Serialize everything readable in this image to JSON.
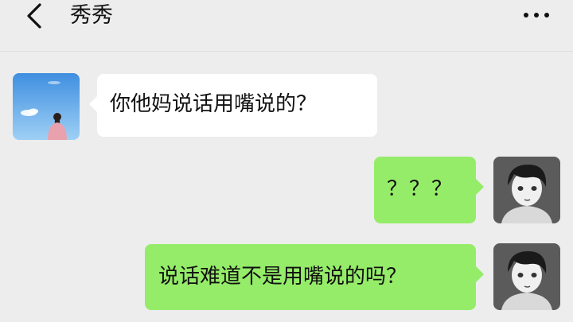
{
  "header": {
    "title": "秀秀",
    "back_icon": "chevron-left-icon",
    "more_icon": "more-dots-icon"
  },
  "messages": [
    {
      "direction": "received",
      "sender": "秀秀",
      "text": "你他妈说话用嘴说的？"
    },
    {
      "direction": "sent",
      "text": "？？？"
    },
    {
      "direction": "sent",
      "text": "说话难道不是用嘴说的吗？"
    }
  ],
  "colors": {
    "background": "#ededed",
    "received_bubble": "#ffffff",
    "sent_bubble": "#95ec69",
    "text": "#111111"
  }
}
